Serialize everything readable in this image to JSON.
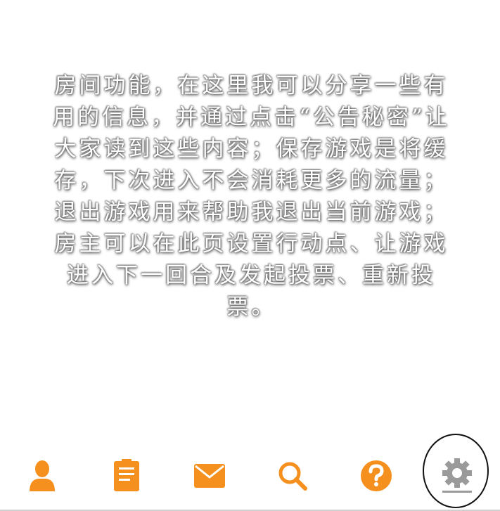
{
  "tutorial": {
    "text": "房间功能，在这里我可以分享一些有用的信息，并通过点击“公告秘密”让大家读到这些内容；保存游戏是将缓存，下次进入不会消耗更多的流量；退出游戏用来帮助我退出当前游戏；房主可以在此页设置行动点、让游戏进入下一回合及发起投票、重新投票。"
  },
  "tabs": [
    {
      "icon": "user-icon"
    },
    {
      "icon": "notepad-icon"
    },
    {
      "icon": "mail-icon"
    },
    {
      "icon": "search-icon"
    },
    {
      "icon": "help-icon"
    },
    {
      "icon": "gear-icon"
    }
  ],
  "colors": {
    "accent": "#f5901e",
    "inactive": "#9a9a9a",
    "highlight": "#111111"
  }
}
